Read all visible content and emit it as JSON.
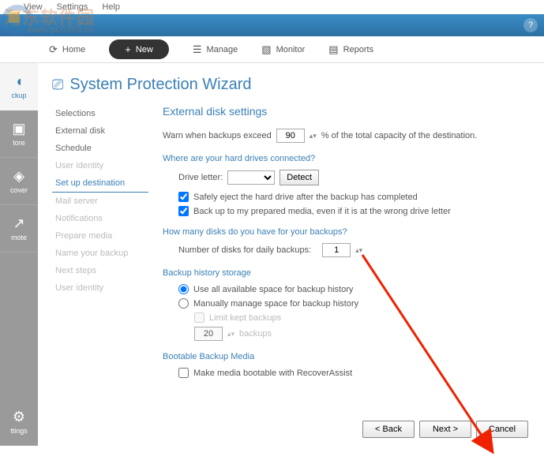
{
  "watermark": {
    "main": "河东软件园",
    "sub": "www.pc0359.cn"
  },
  "menubar": {
    "view": "View",
    "settings": "Settings",
    "help": "Help"
  },
  "tabs": {
    "home": "Home",
    "new": "New",
    "manage": "Manage",
    "monitor": "Monitor",
    "reports": "Reports"
  },
  "sidebar": {
    "backup": "ckup",
    "store": "tore",
    "cover": "cover",
    "mote": "mote",
    "ttings": "ttings"
  },
  "title": "System Protection Wizard",
  "steps": {
    "selections": "Selections",
    "external": "External disk",
    "schedule": "Schedule",
    "userid": "User identity",
    "setup": "Set up destination",
    "mail": "Mail server",
    "notif": "Notifications",
    "prepare": "Prepare media",
    "name": "Name your backup",
    "next": "Next steps",
    "userid2": "User identity"
  },
  "panel": {
    "title": "External disk settings",
    "warn_label": "Warn when backups exceed",
    "warn_value": "90",
    "warn_suffix": "% of the total capacity of the destination.",
    "where_head": "Where are your hard drives connected?",
    "drive_label": "Drive letter:",
    "detect": "Detect",
    "safe_eject": "Safely eject the hard drive after the backup has completed",
    "backup_prepared": "Back up to my prepared media, even if it is at the wrong drive letter",
    "howmany_head": "How many disks do you have for your backups?",
    "num_disks_label": "Number of disks for daily backups:",
    "num_disks_value": "1",
    "history_head": "Backup history storage",
    "use_all": "Use all available space for backup history",
    "manual": "Manually manage space for backup history",
    "limit": "Limit kept backups",
    "limit_value": "20",
    "limit_suffix": "backups",
    "bootable_head": "Bootable Backup Media",
    "bootable_chk": "Make media bootable with RecoverAssist"
  },
  "footer": {
    "back": "< Back",
    "next": "Next >",
    "cancel": "Cancel"
  }
}
